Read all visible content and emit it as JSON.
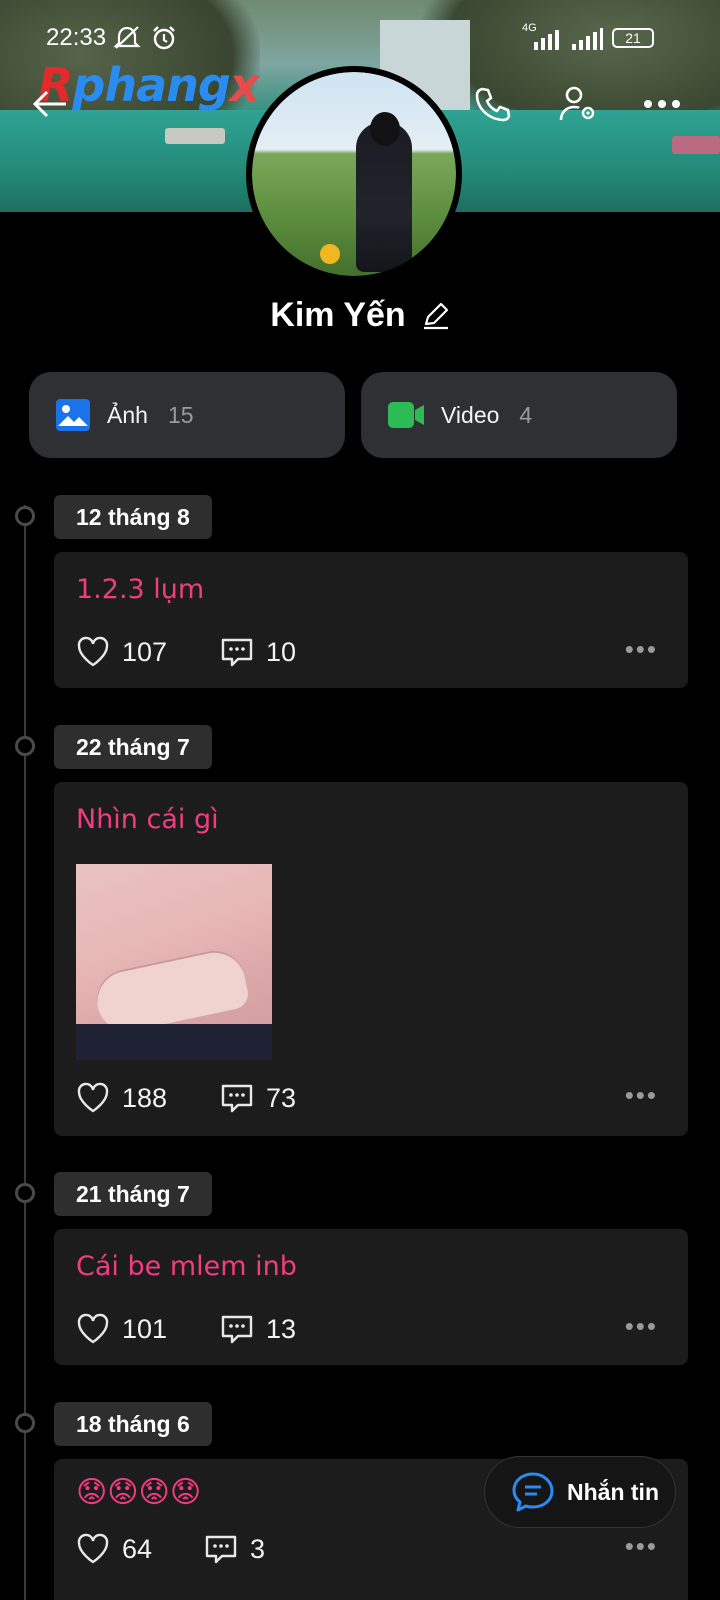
{
  "status_bar": {
    "time": "22:33",
    "network": "4G",
    "battery": "21"
  },
  "watermark": {
    "part1": "R",
    "part2": "phang",
    "part3": "x"
  },
  "profile": {
    "name": "Kim Yến"
  },
  "media": [
    {
      "label": "Ảnh",
      "count": "15",
      "icon": "photo-icon",
      "color": "#1a73e8"
    },
    {
      "label": "Video",
      "count": "4",
      "icon": "video-icon",
      "color": "#2dbb55"
    }
  ],
  "posts": [
    {
      "date": "12 tháng 8",
      "text": "1.2.3 lụm",
      "likes": "107",
      "comments": "10"
    },
    {
      "date": "22 tháng 7",
      "text": "Nhìn cái gì",
      "likes": "188",
      "comments": "73"
    },
    {
      "date": "21 tháng 7",
      "text": "Cái be mlem inb",
      "likes": "101",
      "comments": "13"
    },
    {
      "date": "18 tháng 6",
      "text": "😟😟😟😟",
      "likes": "64",
      "comments": "3"
    }
  ],
  "fab": {
    "label": "Nhắn tin"
  },
  "colors": {
    "accent_pink": "#f03d7c",
    "message_blue": "#2a8cf0"
  }
}
